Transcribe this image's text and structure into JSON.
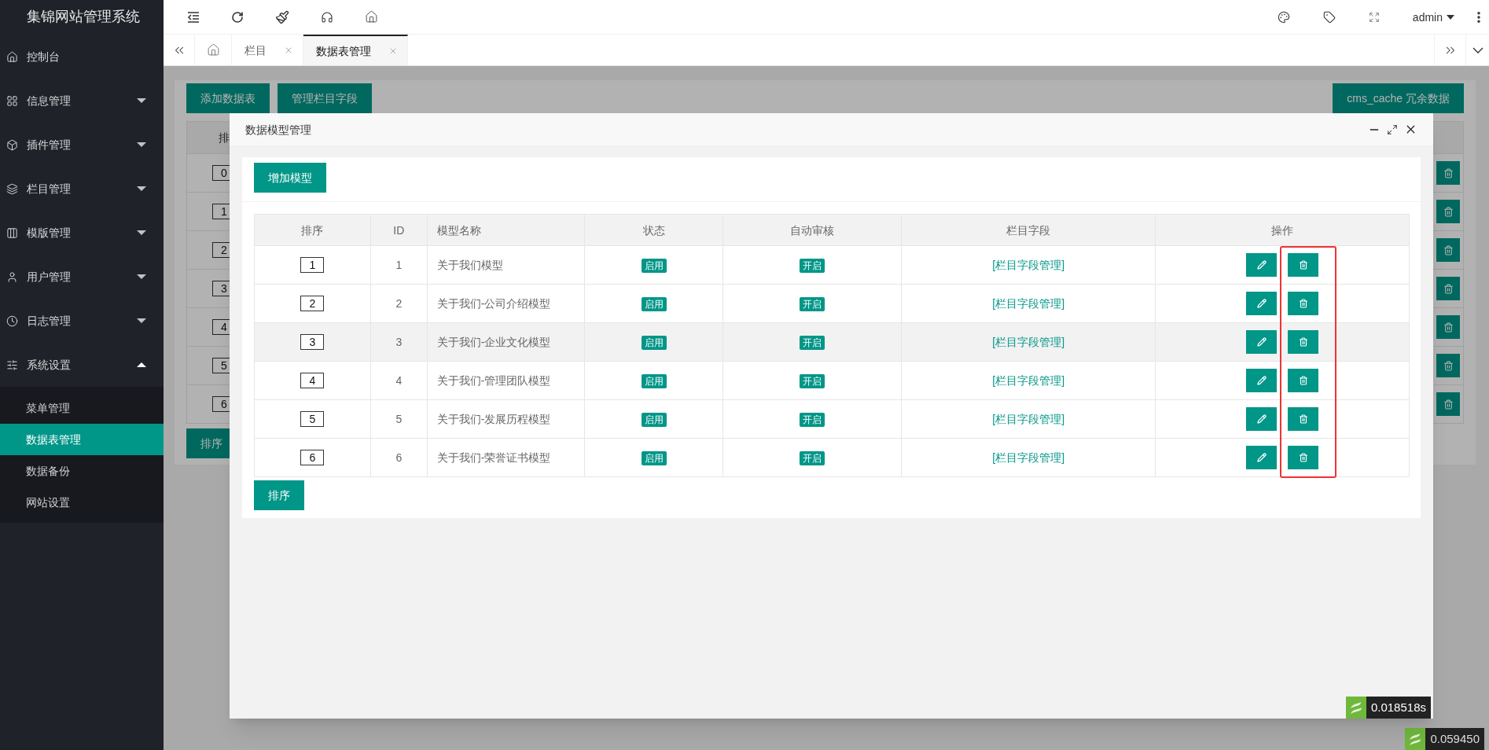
{
  "app_title": "集锦网站管理系统",
  "sidebar": {
    "items": [
      {
        "label": "控制台"
      },
      {
        "label": "信息管理",
        "expanded": false
      },
      {
        "label": "插件管理",
        "expanded": false
      },
      {
        "label": "栏目管理",
        "expanded": false
      },
      {
        "label": "模版管理",
        "expanded": false
      },
      {
        "label": "用户管理",
        "expanded": false
      },
      {
        "label": "日志管理",
        "expanded": false
      },
      {
        "label": "系统设置",
        "expanded": true,
        "children": [
          {
            "label": "菜单管理",
            "selected": false
          },
          {
            "label": "数据表管理",
            "selected": true
          },
          {
            "label": "数据备份",
            "selected": false
          },
          {
            "label": "网站设置",
            "selected": false
          }
        ]
      }
    ]
  },
  "header": {
    "user": "admin"
  },
  "tabs": [
    {
      "label": "栏目",
      "selected": false
    },
    {
      "label": "数据表管理",
      "selected": true
    }
  ],
  "background_page": {
    "buttons": [
      "添加数据表",
      "管理栏目字段",
      "cms_cache 冗余数据"
    ],
    "table_header": "排",
    "order_values": [
      "0",
      "1",
      "2",
      "3",
      "4",
      "5",
      "6"
    ],
    "sort_button": "排序"
  },
  "dialog": {
    "title": "数据模型管理",
    "add_button": "增加模型",
    "table": {
      "columns": [
        "排序",
        "ID",
        "模型名称",
        "状态",
        "自动审核",
        "栏目字段",
        "操作"
      ],
      "rows": [
        {
          "order": "1",
          "id": "1",
          "name": "关于我们模型",
          "status": "启用",
          "auto_review": "开启",
          "fields_link": "[栏目字段管理]",
          "highlighted": false
        },
        {
          "order": "2",
          "id": "2",
          "name": "关于我们-公司介绍模型",
          "status": "启用",
          "auto_review": "开启",
          "fields_link": "[栏目字段管理]",
          "highlighted": false
        },
        {
          "order": "3",
          "id": "3",
          "name": "关于我们-企业文化模型",
          "status": "启用",
          "auto_review": "开启",
          "fields_link": "[栏目字段管理]",
          "highlighted": true
        },
        {
          "order": "4",
          "id": "4",
          "name": "关于我们-管理团队模型",
          "status": "启用",
          "auto_review": "开启",
          "fields_link": "[栏目字段管理]",
          "highlighted": false
        },
        {
          "order": "5",
          "id": "5",
          "name": "关于我们-发展历程模型",
          "status": "启用",
          "auto_review": "开启",
          "fields_link": "[栏目字段管理]",
          "highlighted": false
        },
        {
          "order": "6",
          "id": "6",
          "name": "关于我们-荣誉证书模型",
          "status": "启用",
          "auto_review": "开启",
          "fields_link": "[栏目字段管理]",
          "highlighted": false
        }
      ]
    },
    "sort_button": "排序",
    "timer": "0.018518s"
  },
  "page_timer": "0.059450"
}
